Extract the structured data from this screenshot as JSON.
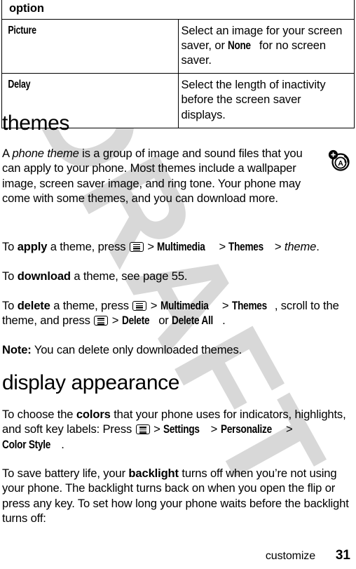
{
  "watermark": {
    "text": "DRAFT",
    "color": "#d8d8d8"
  },
  "options_table": {
    "header": "option",
    "rows": [
      {
        "key": "Picture",
        "desc_1": "Select an image for your screen saver, or ",
        "desc_ui": "None",
        "desc_2": " for no screen saver."
      },
      {
        "key": "Delay",
        "desc_1": "Select the length of inactivity before the screen saver displays.",
        "desc_ui": "",
        "desc_2": ""
      }
    ]
  },
  "themes": {
    "heading": "themes",
    "intro_a": "A ",
    "intro_em": "phone theme",
    "intro_b": " is a group of image and sound files that you can apply to your phone. Most themes include a wallpaper image, screen saver image, and ring tone. Your phone may come with some themes, and you can download more.",
    "apply": {
      "t1": "To ",
      "bold": "apply",
      "t2": " a theme, press ",
      "menu_key_icon": "menu-key-icon",
      "sep1": " > ",
      "ui1": "Multimedia",
      "sep2": " > ",
      "ui2": "Themes",
      "sep3": " > ",
      "em": "theme",
      "t3": "."
    },
    "download": {
      "t1": "To ",
      "bold": "download",
      "t2": " a theme, see page 55."
    },
    "delete": {
      "t1": "To ",
      "bold": "delete",
      "t2": " a theme, press ",
      "sep1": " > ",
      "ui1": "Multimedia",
      "sep2": " > ",
      "ui2": "Themes",
      "t3": ",  scroll to the theme, and press ",
      "sep3": " > ",
      "ui3": "Delete",
      "t4": " or ",
      "ui4": "Delete All",
      "t5": "."
    },
    "note": {
      "label": "Note:",
      "text": " You can delete only downloaded themes."
    }
  },
  "display_appearance": {
    "heading": "display appearance",
    "colors": {
      "t1": "To choose the ",
      "bold": "colors",
      "t2": " that your phone uses for indicators, highlights, and soft key labels: Press ",
      "sep1": " > ",
      "ui1": "Settings",
      "sep2": " > ",
      "ui2": "Personalize",
      "sep3": " > ",
      "ui3": "Color Style",
      "t3": "."
    },
    "backlight": {
      "t1": "To save battery life, your ",
      "bold": "backlight",
      "t2": " turns off when you’re not using your phone. The backlight turns back on when you open the flip or press any key. To set how long your phone waits before the backlight turns off:"
    }
  },
  "margin_icon": {
    "name": "audio-theme-icon"
  },
  "footer": {
    "section": "customize",
    "page": "31"
  }
}
